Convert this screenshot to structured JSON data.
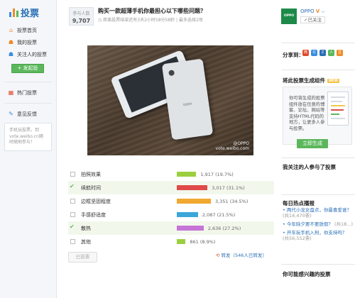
{
  "brand": {
    "title": "投票"
  },
  "sidebar": {
    "items": [
      {
        "label": "投票首页",
        "icon": "home-icon"
      },
      {
        "label": "我的投票",
        "icon": "person-icon"
      },
      {
        "label": "关注人的投票",
        "icon": "people-icon"
      }
    ],
    "create_label": "+ 发起投",
    "hot_label": "热门投票",
    "feedback_label": "意见反馈",
    "mobile_text": "手机玩投票，到vote.weibo.cn随时随地参与！"
  },
  "vote": {
    "count_label": "参与人数",
    "count": "9,707",
    "title": "购买一款超薄手机你最担心以下哪些问题？",
    "meta": "距离投票结束还有3天2小时58分58秒 | 最多选择2项",
    "watermark_handle": "@OPPO",
    "watermark_site": "vote.weibo.com",
    "options": [
      {
        "label": "拍照效果",
        "count": "1,917",
        "percent": 19.7,
        "percent_label": "(19.7%)",
        "color": "#9ccf3f",
        "checked": false
      },
      {
        "label": "续航时间",
        "count": "3,017",
        "percent": 31.1,
        "percent_label": "(31.1%)",
        "color": "#e04a4a",
        "checked": true
      },
      {
        "label": "边框坚固程度",
        "count": "3,351",
        "percent": 34.5,
        "percent_label": "(34.5%)",
        "color": "#f0a830",
        "checked": false
      },
      {
        "label": "手感舒适度",
        "count": "2,087",
        "percent": 21.5,
        "percent_label": "(21.5%)",
        "color": "#3aa7d8",
        "checked": false
      },
      {
        "label": "散热",
        "count": "2,636",
        "percent": 27.2,
        "percent_label": "(27.2%)",
        "color": "#c774d8",
        "checked": true
      },
      {
        "label": "其他",
        "count": "861",
        "percent": 8.9,
        "percent_label": "(8.9%)",
        "color": "#9ccf3f",
        "checked": false
      }
    ],
    "vote_button": "已投票",
    "share_label": "转发（546人已转发）"
  },
  "right": {
    "oppo_logo": "OPPO",
    "oppo_name": "OPPO",
    "follow_label": "✓已关注",
    "share_to": "分享到：",
    "widget_title": "将此投票生成组件",
    "new_badge": "NEW",
    "widget_text": "你可将生成的投票组件放在任意的博客、论坛、网站等支持HTML代码的地方，让更多人参与投票。",
    "widget_button": "立即生成",
    "following_title": "我关注的人参与了投票",
    "hot_title": "每日热点播报",
    "hot_items": [
      {
        "text": "• 两代小龙女盘点，你最喜爱谁？",
        "count": "(共14,470票)"
      },
      {
        "text": "• 今年除夕要不要放假？",
        "count": "(共18...)"
      },
      {
        "text": "• 开车玩手机入刑，你支持吗？",
        "count": "(共56,552票)"
      }
    ],
    "interest_title": "你可能感兴趣的投票"
  }
}
